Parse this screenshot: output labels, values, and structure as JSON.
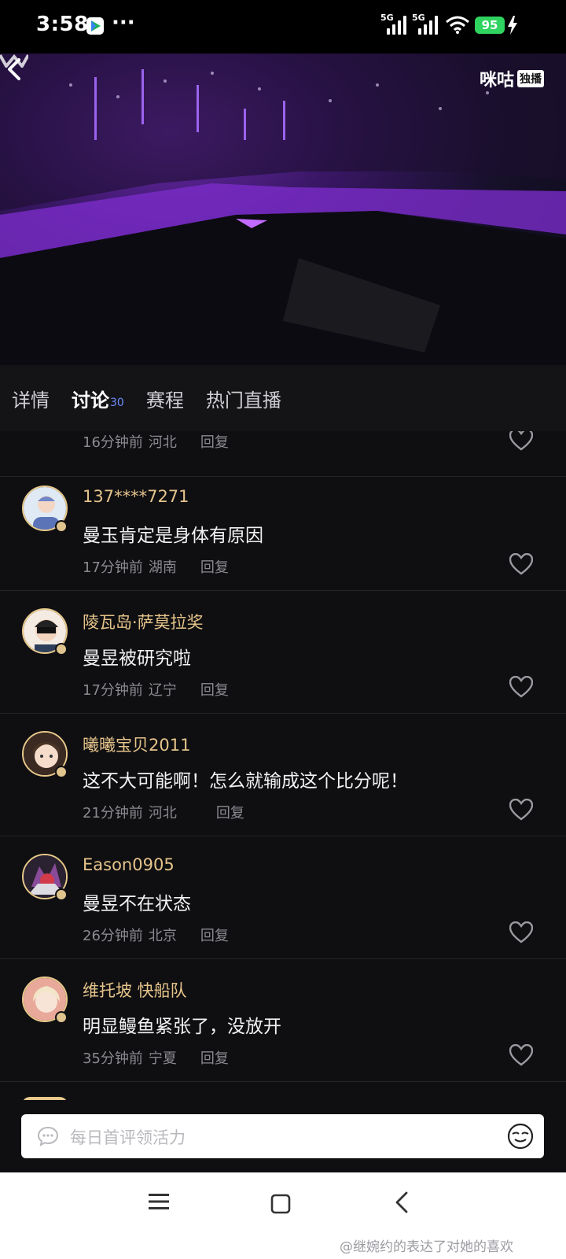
{
  "status_bar": {
    "time": "3:58",
    "dots": "···",
    "network1": "5G",
    "network2": "5G",
    "battery": "95"
  },
  "video": {
    "brand": "咪咕",
    "brand_tag": "独播"
  },
  "tabs": [
    {
      "label": "详情"
    },
    {
      "label": "讨论",
      "count": "30"
    },
    {
      "label": "赛程"
    },
    {
      "label": "热门直播"
    }
  ],
  "partial_comment": {
    "time": "16分钟前",
    "location": "河北",
    "reply": "回复"
  },
  "comments": [
    {
      "username": "137****7271",
      "text": "曼玉肯定是身体有原因",
      "time": "17分钟前",
      "location": "湖南",
      "reply": "回复",
      "avatar_color": "#cfe1f3"
    },
    {
      "username": "陵瓦岛·萨莫拉奖",
      "text": "曼昱被研究啦",
      "time": "17分钟前",
      "location": "辽宁",
      "reply": "回复",
      "avatar_color": "#f1e7dc"
    },
    {
      "username": "曦曦宝贝2011",
      "text": "这不大可能啊！怎么就输成这个比分呢！",
      "time": "21分钟前",
      "location": "河北",
      "reply": "回复",
      "avatar_color": "#d9b8a0"
    },
    {
      "username": "Eason0905",
      "text": "曼昱不在状态",
      "time": "26分钟前",
      "location": "北京",
      "reply": "回复",
      "avatar_color": "#5a3a5e"
    },
    {
      "username": "维托坡 快船队",
      "text": "明显鳗鱼紧张了，没放开",
      "time": "35分钟前",
      "location": "宁夏",
      "reply": "回复",
      "avatar_color": "#e6a99a"
    }
  ],
  "input": {
    "placeholder": "每日首评领活力"
  },
  "watermark": "@继婉约的表达了对她的喜欢",
  "colors": {
    "username": "#e6c48a",
    "accent_count": "#6d8cff",
    "battery": "#2fd35f"
  }
}
